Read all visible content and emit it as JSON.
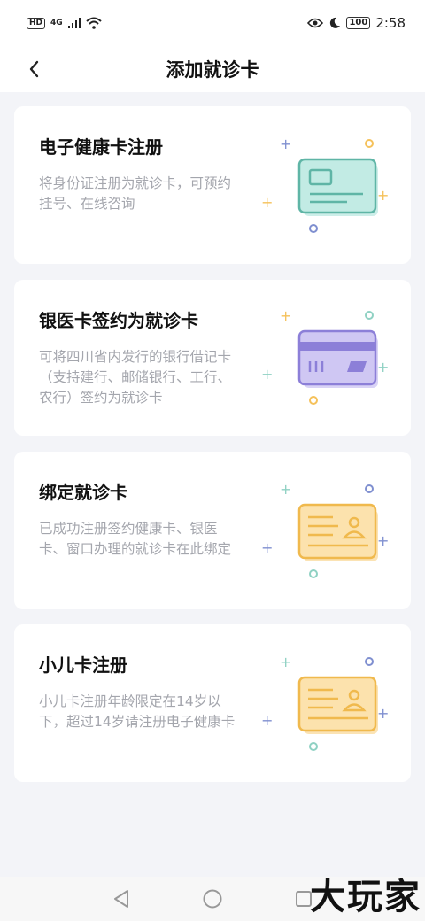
{
  "status_bar": {
    "hd": "HD",
    "network": "4G",
    "battery": "100",
    "time": "2:58"
  },
  "header": {
    "title": "添加就诊卡"
  },
  "cards": [
    {
      "title": "电子健康卡注册",
      "desc": "将身份证注册为就诊卡，可预约挂号、在线咨询",
      "icon": "health-card-icon"
    },
    {
      "title": "银医卡签约为就诊卡",
      "desc": "可将四川省内发行的银行借记卡（支持建行、邮储银行、工行、农行）签约为就诊卡",
      "icon": "bank-card-icon"
    },
    {
      "title": "绑定就诊卡",
      "desc": "已成功注册签约健康卡、银医卡、窗口办理的就诊卡在此绑定",
      "icon": "id-card-icon"
    },
    {
      "title": "小儿卡注册",
      "desc": "小儿卡注册年龄限定在14岁以下，超过14岁请注册电子健康卡",
      "icon": "child-id-card-icon"
    }
  ],
  "colors": {
    "teal": "#5fb5a6",
    "purple": "#8c7fd8",
    "orange": "#f5c15a",
    "blue_plus": "#7f8fd0"
  },
  "watermark": "大玩家"
}
